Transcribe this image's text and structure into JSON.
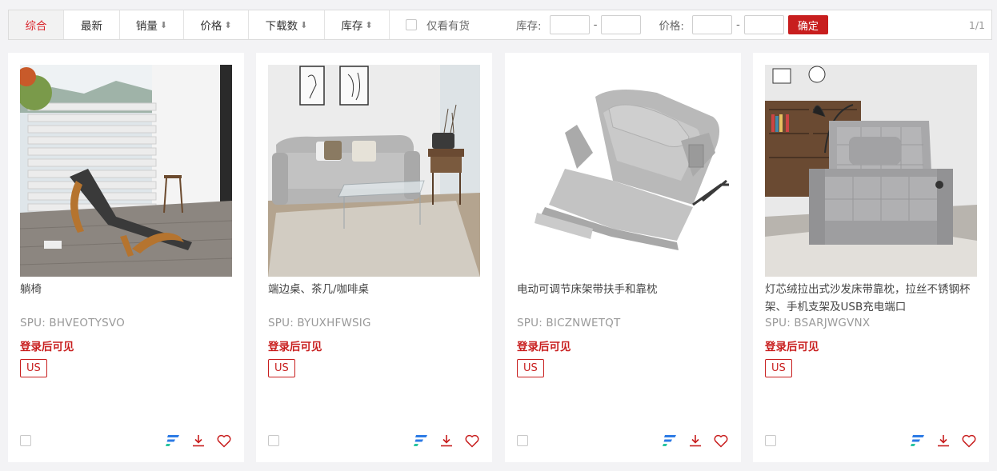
{
  "toolbar": {
    "sort_tabs": [
      {
        "label": "综合",
        "arrow": ""
      },
      {
        "label": "最新",
        "arrow": ""
      },
      {
        "label": "销量",
        "arrow": "⬇"
      },
      {
        "label": "价格",
        "arrow": "⬍"
      },
      {
        "label": "下载数",
        "arrow": "⬇"
      },
      {
        "label": "库存",
        "arrow": "⬍"
      }
    ],
    "in_stock_label": "仅看有货",
    "stock_label": "库存:",
    "price_label": "价格:",
    "range_dash": "-",
    "confirm_label": "确定",
    "pagination": "1/1"
  },
  "products": [
    {
      "title": "躺椅",
      "spu": "SPU:  BHVEOTYSVO",
      "price_text": "登录后可见",
      "region": "US"
    },
    {
      "title": "端边桌、茶几/咖啡桌",
      "spu": "SPU:  BYUXHFWSIG",
      "price_text": "登录后可见",
      "region": "US"
    },
    {
      "title": "电动可调节床架带扶手和靠枕",
      "spu": "SPU:  BICZNWETQT",
      "price_text": "登录后可见",
      "region": "US"
    },
    {
      "title": "灯芯绒拉出式沙发床带靠枕，拉丝不锈钢杯架、手机支架及USB充电端口",
      "spu": "SPU:  BSARJWGVNX",
      "price_text": "登录后可见",
      "region": "US"
    }
  ],
  "icons": {
    "share": "share-brand-icon",
    "download": "download-icon",
    "favorite": "heart-icon"
  },
  "colors": {
    "accent": "#c81e1e",
    "brand_blue": "#2d7be5",
    "brand_green": "#28c4a0"
  }
}
